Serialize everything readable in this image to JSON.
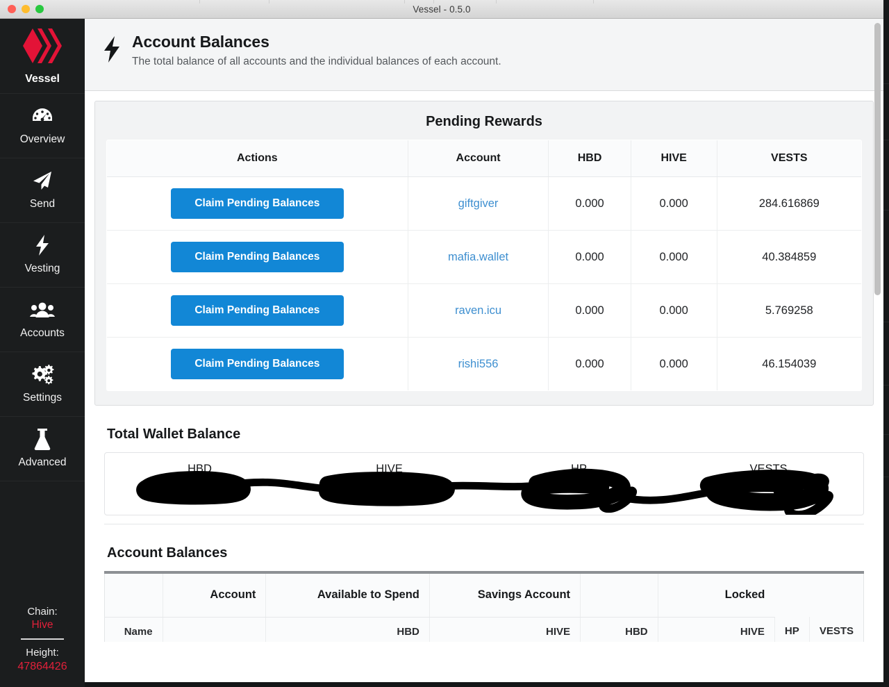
{
  "window": {
    "title": "Vessel - 0.5.0",
    "traffic_lights": [
      "close",
      "minimize",
      "zoom"
    ]
  },
  "sidebar": {
    "brand": {
      "label": "Vessel",
      "icon": "hive-logo-icon"
    },
    "items": [
      {
        "label": "Overview",
        "icon": "speedometer-icon"
      },
      {
        "label": "Send",
        "icon": "paper-plane-icon"
      },
      {
        "label": "Vesting",
        "icon": "lightning-bolt-icon"
      },
      {
        "label": "Accounts",
        "icon": "users-group-icon"
      },
      {
        "label": "Settings",
        "icon": "gears-icon"
      },
      {
        "label": "Advanced",
        "icon": "flask-icon"
      }
    ],
    "status": {
      "chain_label": "Chain:",
      "chain_value": "Hive",
      "height_label": "Height:",
      "height_value": "47864426",
      "accent_color": "#e3203a"
    }
  },
  "header": {
    "icon": "lightning-bolt-icon",
    "title": "Account Balances",
    "subtitle": "The total balance of all accounts and the individual balances of each account."
  },
  "pending_rewards": {
    "title": "Pending Rewards",
    "columns": [
      "Actions",
      "Account",
      "HBD",
      "HIVE",
      "VESTS"
    ],
    "button_label": "Claim Pending Balances",
    "button_color": "#1287d6",
    "rows": [
      {
        "action": "Claim Pending Balances",
        "account": "giftgiver",
        "hbd": "0.000",
        "hive": "0.000",
        "vests": "284.616869"
      },
      {
        "action": "Claim Pending Balances",
        "account": "mafia.wallet",
        "hbd": "0.000",
        "hive": "0.000",
        "vests": "40.384859"
      },
      {
        "action": "Claim Pending Balances",
        "account": "raven.icu",
        "hbd": "0.000",
        "hive": "0.000",
        "vests": "5.769258"
      },
      {
        "action": "Claim Pending Balances",
        "account": "rishi556",
        "hbd": "0.000",
        "hive": "0.000",
        "vests": "46.154039"
      }
    ]
  },
  "total_wallet_balance": {
    "title": "Total Wallet Balance",
    "columns": [
      "HBD",
      "HIVE",
      "HP",
      "VESTS"
    ],
    "values": [
      "[redacted]",
      "[redacted]",
      "[redacted]",
      "[redacted]"
    ],
    "redacted": true
  },
  "account_balances": {
    "title": "Account Balances",
    "group_headers": [
      "",
      "Account",
      "Available to Spend",
      "Savings Account",
      "",
      "Locked"
    ],
    "sub_headers": [
      "Name",
      "",
      "HBD",
      "HIVE",
      "HBD",
      "HIVE",
      "HP",
      "VESTS"
    ]
  },
  "scrollbar": {
    "name": "vertical-scrollbar"
  }
}
